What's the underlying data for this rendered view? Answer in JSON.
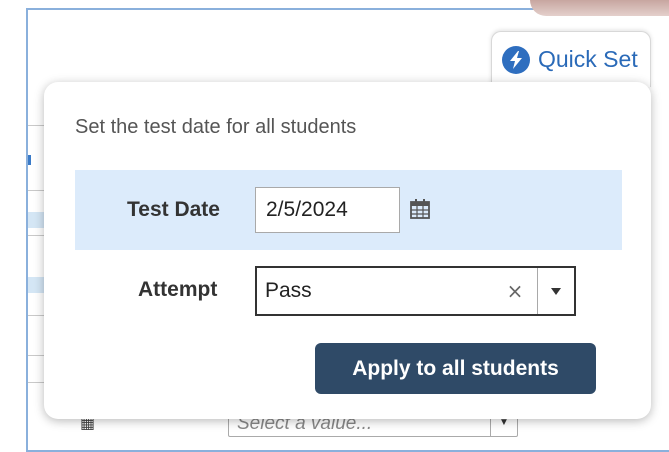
{
  "quick_set": {
    "label": "Quick Set",
    "icon": "lightning-bolt-icon",
    "accent_color": "#2a6ab8"
  },
  "popover": {
    "description": "Set the test date for all students",
    "test_date": {
      "label": "Test Date",
      "value": "2/5/2024",
      "icon": "calendar-icon"
    },
    "attempt": {
      "label": "Attempt",
      "value": "Pass",
      "clear_icon": "×",
      "caret_icon": "chevron-down-icon"
    },
    "apply_button": {
      "label": "Apply to all students",
      "color": "#2f4a67"
    }
  },
  "background": {
    "select_placeholder": "Select a value...",
    "highlight_color": "#dcebfb"
  }
}
